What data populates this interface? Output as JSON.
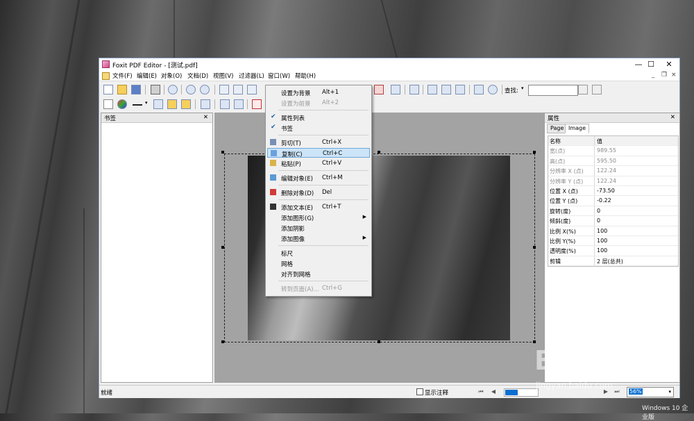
{
  "window": {
    "title": "Foxit PDF Editor - [测试.pdf]",
    "minimize": "—",
    "maximize": "☐",
    "close": "✕"
  },
  "menubar": [
    "文件(F)",
    "编辑(E)",
    "对象(O)",
    "文档(D)",
    "视图(V)",
    "过滤器(L)",
    "窗口(W)",
    "帮助(H)"
  ],
  "toolbar": {
    "search_label": "查找:",
    "search_value": ""
  },
  "bookmark_panel": {
    "title": "书签",
    "close": "✕"
  },
  "context_menu": [
    {
      "label": "设置为背景",
      "shortcut": "Alt+1",
      "enabled": true
    },
    {
      "label": "设置为前景",
      "shortcut": "Alt+2",
      "enabled": false
    },
    {
      "label": "属性列表",
      "shortcut": "",
      "enabled": true,
      "checked": true
    },
    {
      "label": "书签",
      "shortcut": "",
      "enabled": true,
      "checked": true
    },
    {
      "label": "剪切(T)",
      "shortcut": "Ctrl+X",
      "enabled": true,
      "icon": "scissors-icon"
    },
    {
      "label": "复制(C)",
      "shortcut": "Ctrl+C",
      "enabled": true,
      "icon": "copy-icon",
      "highlighted": true
    },
    {
      "label": "粘贴(P)",
      "shortcut": "Ctrl+V",
      "enabled": true,
      "icon": "paste-icon"
    },
    {
      "label": "编辑对象(E)",
      "shortcut": "Ctrl+M",
      "enabled": true,
      "icon": "edit-object-icon"
    },
    {
      "label": "删除对象(D)",
      "shortcut": "Del",
      "enabled": true,
      "icon": "delete-icon"
    },
    {
      "label": "添加文本(E)",
      "shortcut": "Ctrl+T",
      "enabled": true,
      "icon": "add-text-icon"
    },
    {
      "label": "添加图形(G)",
      "shortcut": "",
      "enabled": true,
      "submenu": true
    },
    {
      "label": "添加阴影",
      "shortcut": "",
      "enabled": true
    },
    {
      "label": "添加图像",
      "shortcut": "",
      "enabled": true,
      "submenu": true
    },
    {
      "label": "标尺",
      "shortcut": "",
      "enabled": true
    },
    {
      "label": "网格",
      "shortcut": "",
      "enabled": true
    },
    {
      "label": "对齐到网格",
      "shortcut": "",
      "enabled": true
    },
    {
      "label": "转到页面(A)...",
      "shortcut": "Ctrl+G",
      "enabled": false
    }
  ],
  "properties_panel": {
    "title": "属性",
    "close": "✕",
    "tabs": [
      "Page",
      "Image"
    ],
    "active_tab": "Image",
    "header": {
      "name": "名称",
      "value": "值"
    },
    "rows": [
      {
        "name": "宽(点)",
        "value": "989.55",
        "dim": true
      },
      {
        "name": "高(点)",
        "value": "595.50",
        "dim": true
      },
      {
        "name": "分辨率 X (点)",
        "value": "122.24",
        "dim": true
      },
      {
        "name": "分辨率 Y (点)",
        "value": "122.24",
        "dim": true
      },
      {
        "name": "位置 X (点)",
        "value": "-73.50",
        "dim": false
      },
      {
        "name": "位置 Y (点)",
        "value": "-0.22",
        "dim": false
      },
      {
        "name": "旋转(度)",
        "value": "0",
        "dim": false
      },
      {
        "name": "倾斜(度)",
        "value": "0",
        "dim": false
      },
      {
        "name": "比例 X(%)",
        "value": "100",
        "dim": false
      },
      {
        "name": "比例 Y(%)",
        "value": "100",
        "dim": false
      },
      {
        "name": "透明度(%)",
        "value": "100",
        "dim": false
      },
      {
        "name": "剪辑",
        "value": "2 层(总共)",
        "dim": false
      }
    ]
  },
  "statusbar": {
    "status": "就绪",
    "show_annotations": "显示注释",
    "zoom": "56%",
    "progress": 0.4
  },
  "watermark": {
    "brand": "Baidu经验",
    "url": "jingyan.baidu.com"
  },
  "os_label": "Windows 10 企业版"
}
